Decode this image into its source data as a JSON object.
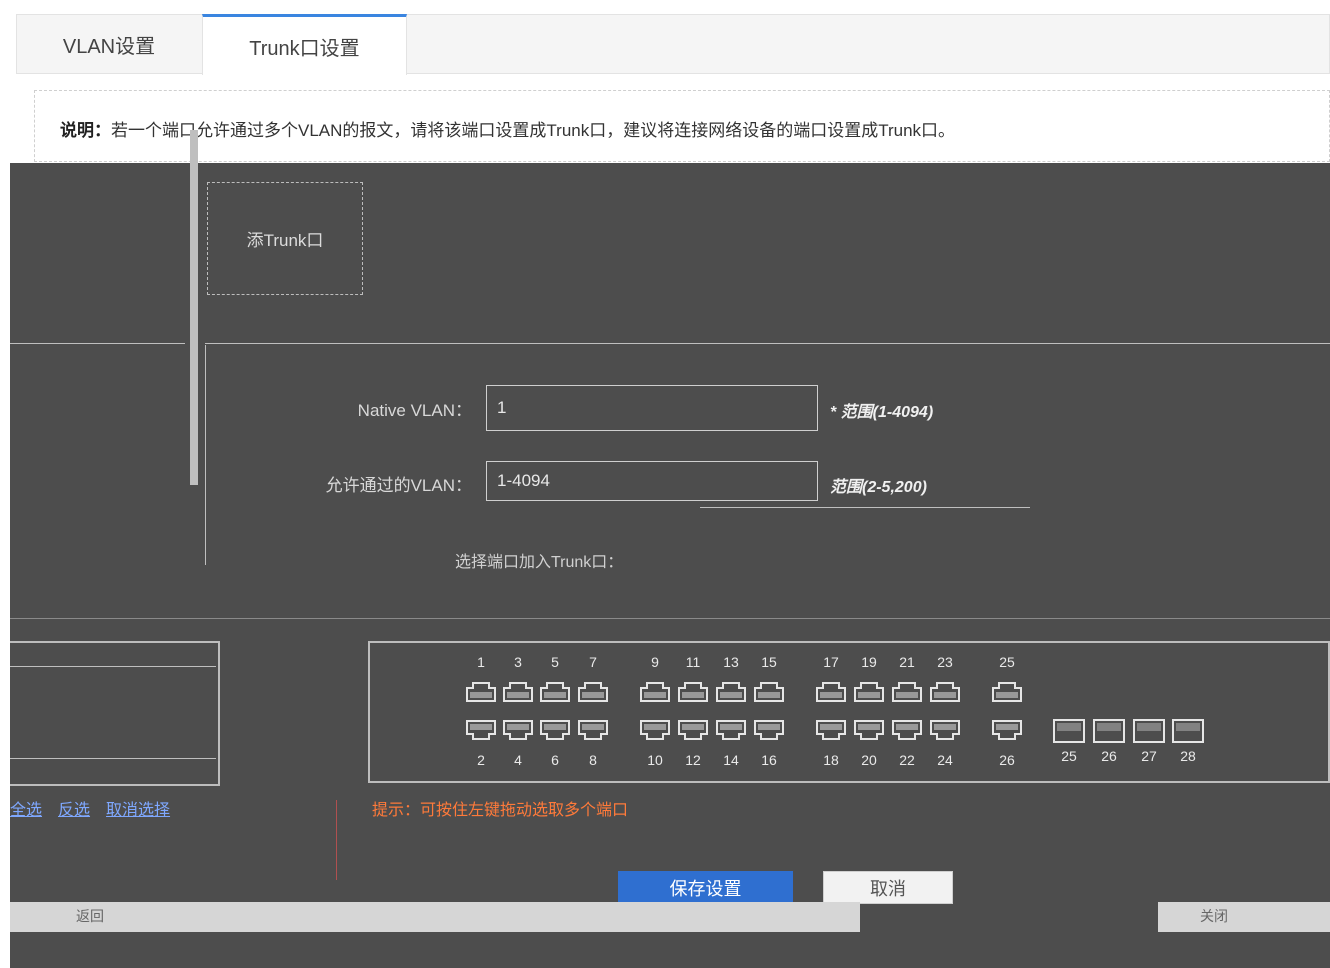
{
  "tabs": [
    {
      "label": "VLAN设置"
    },
    {
      "label": "Trunk口设置"
    }
  ],
  "description": {
    "prefix": "说明：",
    "text": "若一个端口允许通过多个VLAN的报文，请将该端口设置成Trunk口，建议将连接网络设备的端口设置成Trunk口。"
  },
  "add_trunk": {
    "label": "添Trunk口"
  },
  "form": {
    "native_vlan": {
      "label": "Native VLAN：",
      "value": "1",
      "hint": "* 范围(1-4094)"
    },
    "allowed_vlan": {
      "label": "允许通过的VLAN：",
      "value": "1-4094",
      "hint": "范围(2-5,200)"
    },
    "select_ports_label": "选择端口加入Trunk口："
  },
  "ports": {
    "top_labels": [
      "1",
      "3",
      "5",
      "7",
      "9",
      "11",
      "13",
      "15",
      "17",
      "19",
      "21",
      "23",
      "25"
    ],
    "bottom_labels": [
      "2",
      "4",
      "6",
      "8",
      "10",
      "12",
      "14",
      "16",
      "18",
      "20",
      "22",
      "24",
      "26"
    ],
    "sfp_labels": [
      "25",
      "26",
      "27",
      "28"
    ]
  },
  "tools": [
    "全选",
    "反选",
    "取消选择"
  ],
  "tip": "提示：可按住左键拖动选取多个端口",
  "buttons": {
    "save": "保存设置",
    "cancel": "取消"
  },
  "footer": {
    "left": "返回",
    "right": "关闭"
  }
}
